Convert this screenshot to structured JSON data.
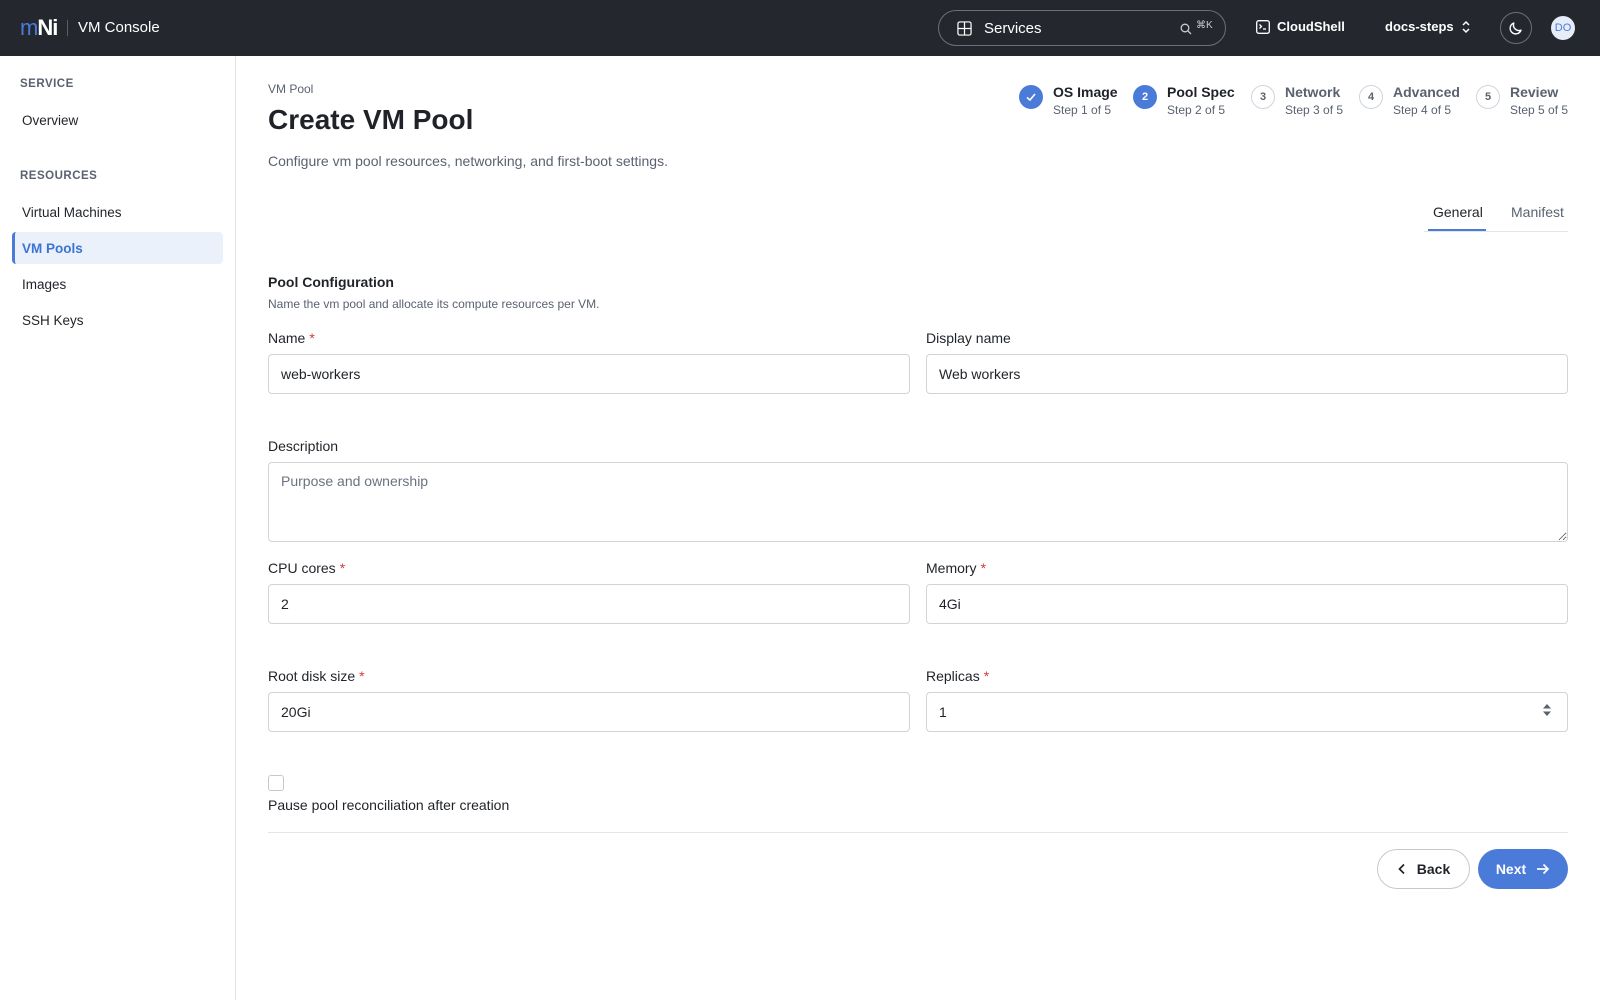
{
  "topbar": {
    "logo_m": "m",
    "logo_ni": "Ni",
    "app_title": "VM Console",
    "services_label": "Services",
    "search_shortcut": "⌘K",
    "cloudshell_label": "CloudShell",
    "namespace": "docs-steps",
    "avatar_initials": "DO"
  },
  "sidebar": {
    "sections": [
      {
        "title": "SERVICE",
        "items": [
          {
            "label": "Overview",
            "active": false
          }
        ]
      },
      {
        "title": "RESOURCES",
        "items": [
          {
            "label": "Virtual Machines",
            "active": false
          },
          {
            "label": "VM Pools",
            "active": true
          },
          {
            "label": "Images",
            "active": false
          },
          {
            "label": "SSH Keys",
            "active": false
          }
        ]
      }
    ]
  },
  "page": {
    "breadcrumb": "VM Pool",
    "title": "Create VM Pool",
    "subtitle": "Configure vm pool resources, networking, and first-boot settings."
  },
  "stepper": [
    {
      "number": "1",
      "name": "OS Image",
      "sub": "Step 1 of 5",
      "state": "done"
    },
    {
      "number": "2",
      "name": "Pool Spec",
      "sub": "Step 2 of 5",
      "state": "current"
    },
    {
      "number": "3",
      "name": "Network",
      "sub": "Step 3 of 5",
      "state": "todo"
    },
    {
      "number": "4",
      "name": "Advanced",
      "sub": "Step 4 of 5",
      "state": "todo"
    },
    {
      "number": "5",
      "name": "Review",
      "sub": "Step 5 of 5",
      "state": "todo"
    }
  ],
  "tabs": [
    {
      "label": "General",
      "active": true
    },
    {
      "label": "Manifest",
      "active": false
    }
  ],
  "form": {
    "section_title": "Pool Configuration",
    "section_desc": "Name the vm pool and allocate its compute resources per VM.",
    "required_mark": "*",
    "name": {
      "label": "Name",
      "value": "web-workers"
    },
    "display_name": {
      "label": "Display name",
      "value": "Web workers"
    },
    "description": {
      "label": "Description",
      "value": "",
      "placeholder": "Purpose and ownership"
    },
    "cpu": {
      "label": "CPU cores",
      "value": "2"
    },
    "memory": {
      "label": "Memory",
      "value": "4Gi"
    },
    "root_disk": {
      "label": "Root disk size",
      "value": "20Gi"
    },
    "replicas": {
      "label": "Replicas",
      "value": "1"
    },
    "pause_label": "Pause pool reconciliation after creation",
    "pause_checked": false
  },
  "actions": {
    "back_label": "Back",
    "next_label": "Next"
  },
  "colors": {
    "accent": "#4a7bd8",
    "topbar": "#24282e",
    "required": "#d03b3b"
  }
}
